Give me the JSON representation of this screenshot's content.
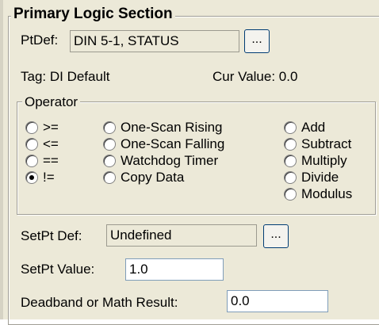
{
  "section_title": "Primary Logic Section",
  "ptdef": {
    "label": "PtDef:",
    "value": "DIN 5-1, STATUS",
    "browse_label": "..."
  },
  "tag": {
    "text": "Tag: DI Default"
  },
  "cur_value": {
    "text": "Cur Value: 0.0"
  },
  "operator": {
    "title": "Operator",
    "col1": [
      {
        "label": ">=",
        "selected": false
      },
      {
        "label": "<=",
        "selected": false
      },
      {
        "label": "==",
        "selected": false
      },
      {
        "label": "!=",
        "selected": true
      }
    ],
    "col2": [
      {
        "label": "One-Scan Rising"
      },
      {
        "label": "One-Scan Falling"
      },
      {
        "label": "Watchdog Timer"
      },
      {
        "label": "Copy Data"
      }
    ],
    "col3": [
      {
        "label": "Add"
      },
      {
        "label": "Subtract"
      },
      {
        "label": "Multiply"
      },
      {
        "label": "Divide"
      },
      {
        "label": "Modulus"
      }
    ]
  },
  "setpt_def": {
    "label": "SetPt Def:",
    "value": "Undefined",
    "browse_label": "..."
  },
  "setpt_value": {
    "label": "SetPt Value:",
    "value": "1.0"
  },
  "deadband": {
    "label": "Deadband or Math Result:",
    "value": "0.0"
  }
}
